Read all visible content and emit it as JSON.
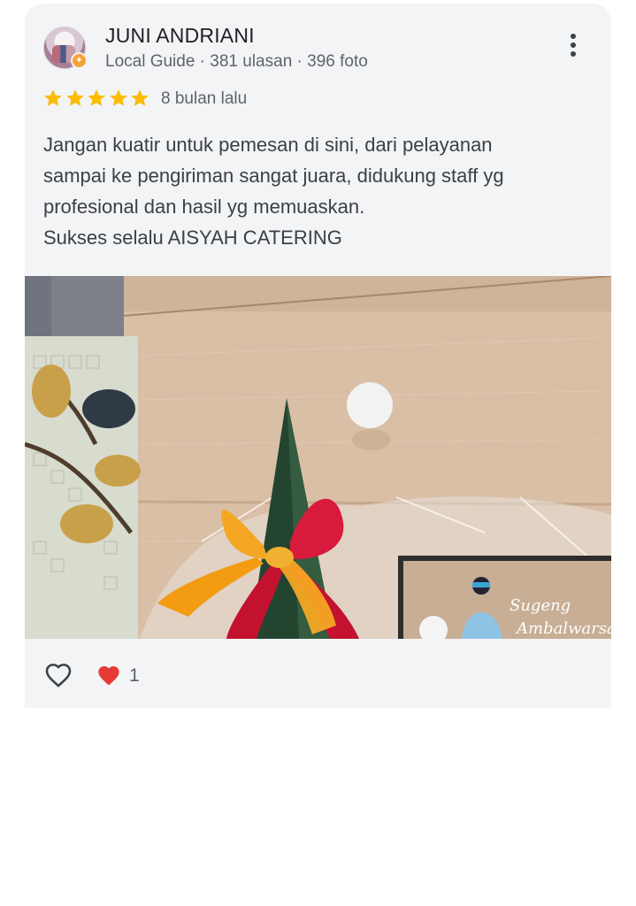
{
  "review": {
    "author_name": "JUNI ANDRIANI",
    "author_meta": "Local Guide · 381 ulasan · 396 foto",
    "rating": 5,
    "time_ago": "8 bulan lalu",
    "text_lines": [
      "Jangan kuatir untuk pemesan di sini, dari pelayanan",
      "sampai ke pengiriman sangat juara, didukung staff yg",
      "profesional dan hasil yg memuaskan.",
      "Sukses selalu AISYAH CATERING"
    ],
    "photo": {
      "caption_script_1": "Sugeng",
      "caption_script_2": "Ambalwarsa"
    },
    "reactions": {
      "like_count": "1"
    }
  },
  "icons": {
    "more": "more-vert-icon",
    "like": "heart-outline-icon",
    "reaction": "heart-filled-icon",
    "star": "star-icon",
    "badge": "local-guide-badge-icon"
  },
  "colors": {
    "card_bg": "#f3f4f6",
    "star": "#fbbc04",
    "reaction_heart": "#e53935"
  }
}
